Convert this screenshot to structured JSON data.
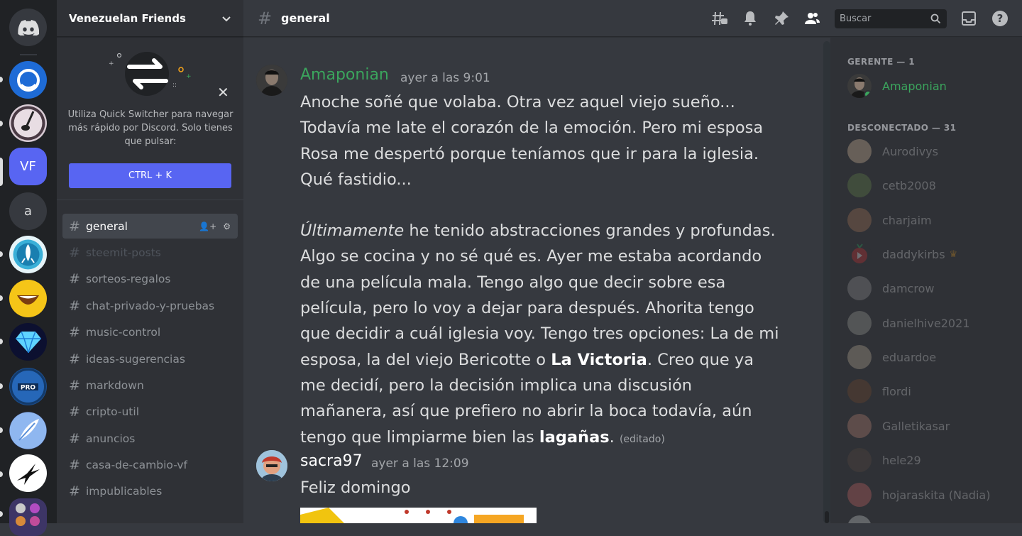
{
  "servers": [
    {
      "label": "a"
    },
    {
      "label": "VF"
    }
  ],
  "guild": {
    "name": "Venezuelan Friends"
  },
  "quick_switcher": {
    "text": "Utiliza Quick Switcher para navegar más rápido por Discord. Solo tienes que pulsar:",
    "button": "CTRL + K"
  },
  "channels": [
    {
      "name": "general"
    },
    {
      "name": "steemit-posts"
    },
    {
      "name": "sorteos-regalos"
    },
    {
      "name": "chat-privado-y-pruebas"
    },
    {
      "name": "music-control"
    },
    {
      "name": "ideas-sugerencias"
    },
    {
      "name": "markdown"
    },
    {
      "name": "cripto-util"
    },
    {
      "name": "anuncios"
    },
    {
      "name": "casa-de-cambio-vf"
    },
    {
      "name": "impublicables"
    }
  ],
  "topbar": {
    "channel": "general",
    "search_placeholder": "Buscar"
  },
  "messages": [
    {
      "author": "Amaponian",
      "timestamp": "ayer a las 9:01",
      "p1": "Anoche soñé que volaba. Otra vez aquel viejo sueño... Todavía me late el corazón de la emoción. Pero mi esposa Rosa me despertó porque teníamos que ir para la iglesia. Qué fastidio...",
      "p2_italic": "Últimamente",
      "p2_a": " he tenido abstracciones grandes y profundas. Algo se cocina y no sé qué es. Ayer me estaba acordando de una película mala. Tengo algo que decir sobre esa película, pero lo voy a dejar para después. Ahorita tengo que decidir a cuál iglesia voy. Tengo tres opciones: La de mi esposa, la del viejo Bericotte o ",
      "p2_bold1": "La Victoria",
      "p2_b": ". Creo que ya me decidí, pero la decisión implica una discusión mañanera, así que prefiero no abrir la boca todavía, aún tengo que limpiarme bien las ",
      "p2_bold2": "lagañas",
      "p2_end": ".",
      "edited": "(editado)"
    },
    {
      "author": "sacra97",
      "timestamp": "ayer a las 12:09",
      "text": "Feliz domingo"
    }
  ],
  "members": {
    "gerente_header": "GERENTE — 1",
    "gerente": [
      {
        "name": "Amaponian"
      }
    ],
    "offline_header": "DESCONECTADO — 31",
    "offline": [
      {
        "name": "Aurodivys"
      },
      {
        "name": "cetb2008"
      },
      {
        "name": "charjaim"
      },
      {
        "name": "daddykirbs"
      },
      {
        "name": "damcrow"
      },
      {
        "name": "danielhive2021"
      },
      {
        "name": "eduardoe"
      },
      {
        "name": "flordi"
      },
      {
        "name": "Galletikasar"
      },
      {
        "name": "hele29"
      },
      {
        "name": "hojaraskita (Nadia)"
      }
    ]
  },
  "colors": {
    "accent": "#5865f2",
    "manager_green": "#3ba55d",
    "online": "#3ba55d"
  }
}
